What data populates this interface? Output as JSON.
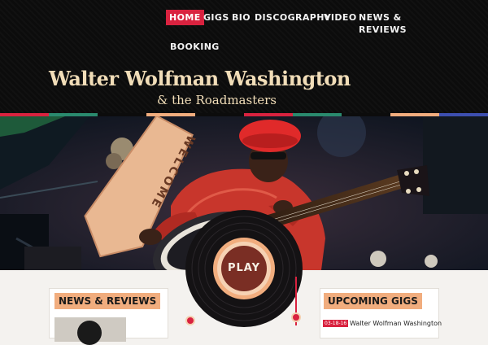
{
  "nav": {
    "items": [
      {
        "label": "HOME",
        "active": true
      },
      {
        "label": "GIGS"
      },
      {
        "label": "BIO"
      },
      {
        "label": "DISCOGRAPHY"
      },
      {
        "label": "VIDEO"
      },
      {
        "label": "NEWS &"
      },
      {
        "label": "REVIEWS"
      },
      {
        "label": "BOOKING"
      }
    ]
  },
  "header": {
    "title": "Walter Wolfman Washington",
    "subtitle": "& the Roadmasters"
  },
  "hero": {
    "sign_text": "WELCOME"
  },
  "player": {
    "play_label": "PLAY"
  },
  "news": {
    "title": "NEWS & REVIEWS"
  },
  "gigs": {
    "title": "UPCOMING GIGS",
    "items": [
      {
        "date": "03-18-16",
        "text": "Walter Wolfman Washington"
      }
    ]
  },
  "colors": {
    "accent_red": "#d9223f",
    "panel_title_bg": "#f1ad7e",
    "logo_cream": "#f1ddb8",
    "stripe_colors": [
      "#d9223f",
      "#2a8a6e",
      "#f1ad7e",
      "#3d4fb0"
    ]
  }
}
